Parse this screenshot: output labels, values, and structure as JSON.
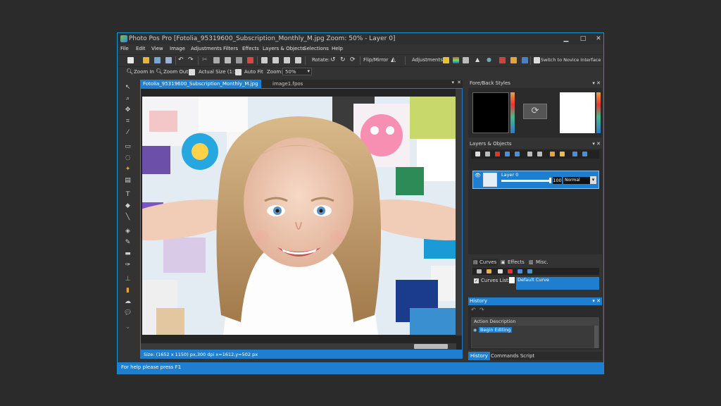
{
  "window": {
    "title": "Photo Pos Pro [Fotolia_95319600_Subscription_Monthly_M.jpg Zoom: 50% - Layer 0]",
    "controls": {
      "minimize": "▁",
      "maximize": "□",
      "close": "✕"
    }
  },
  "menu": [
    "File",
    "Edit",
    "View",
    "Image",
    "Adjustments",
    "Filters",
    "Effects",
    "Layers & Objects",
    "Selections",
    "Help"
  ],
  "toolbar1": {
    "rotate_label": "Rotate:",
    "flip_label": "Flip/Mirror",
    "adjustments_label": "Adjustments:",
    "novice_label": "Switch to Novice Interface"
  },
  "toolbar2": {
    "zoom_in": "Zoom In",
    "zoom_out": "Zoom Out",
    "actual_size": "Actual Size (1:1)",
    "auto_fit": "Auto Fit",
    "zoom_label": "Zoom:",
    "zoom_value": "50%"
  },
  "doc_tabs": {
    "active": "Fotolia_95319600_Subscription_Monthly_M.jpg",
    "other": "image1.fpos"
  },
  "image_status": "Size: (1652 x 1150) px,300 dpi  x=1612,y=502 px",
  "status_bar": "For help please press F1",
  "panels": {
    "fore_back": {
      "title": "Fore/Back Styles",
      "fore_color": "#000000",
      "back_color": "#ffffff"
    },
    "layers": {
      "title": "Layers & Objects",
      "layer_name": "Layer 0",
      "opacity": "100",
      "blend_mode": "Normal"
    },
    "curves_tabs": [
      "Curves",
      "Effects",
      "Misc."
    ],
    "curves_list_label": "Curves List:",
    "curves_list_value": "Default Curve",
    "history": {
      "title": "History",
      "column": "Action Description",
      "items": [
        "Begin Editing"
      ],
      "tabs": [
        "History",
        "Commands Script"
      ]
    }
  },
  "colors": {
    "accent": "#1e7fd0",
    "bg": "#333333"
  }
}
